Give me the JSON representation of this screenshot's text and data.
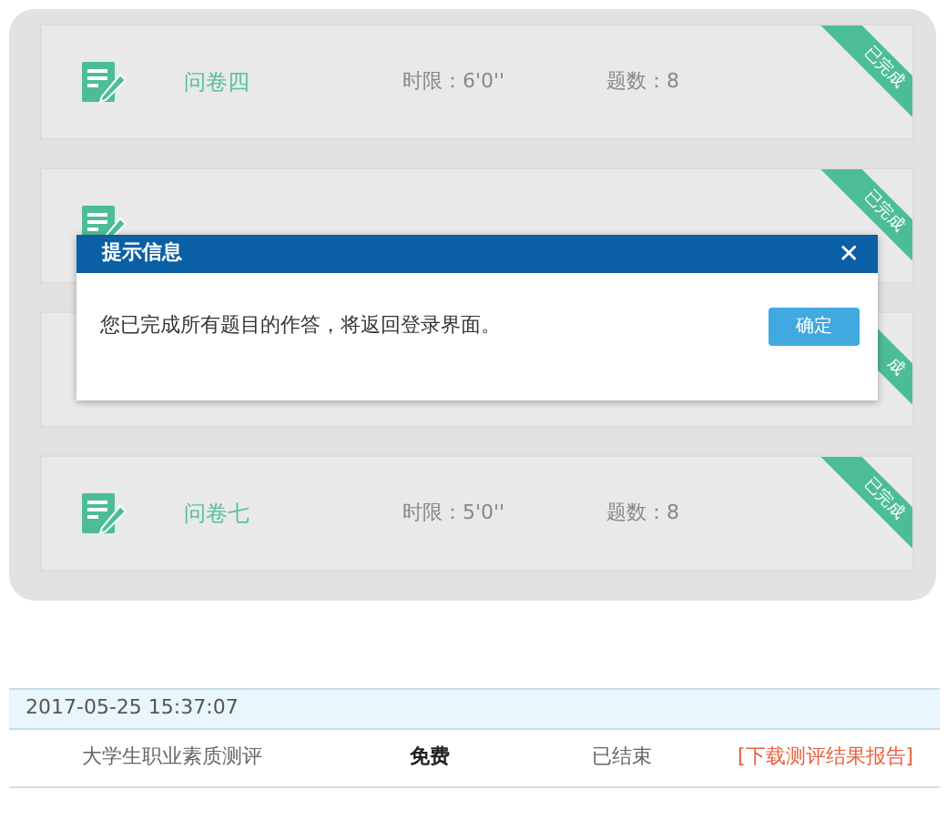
{
  "surveys": [
    {
      "title": "问卷四",
      "time_limit": "时限：6'0''",
      "question_count": "题数：8",
      "completed": true,
      "badge": "已完成"
    },
    {
      "completed": true,
      "badge": "已完成"
    },
    {
      "completed": true,
      "badge": "成"
    },
    {
      "title": "问卷七",
      "time_limit": "时限：5'0''",
      "question_count": "题数：8",
      "completed": true,
      "badge": "已完成"
    }
  ],
  "dialog": {
    "title": "提示信息",
    "close": "✕",
    "message": "您已完成所有题目的作答，将返回登录界面。",
    "confirm": "确定"
  },
  "records": [
    {
      "date": "2017-05-25 15:37:07",
      "name": "大学生职业素质测评",
      "price": "免费",
      "status": "已结束",
      "link": "[下载测评结果报告]"
    }
  ]
}
